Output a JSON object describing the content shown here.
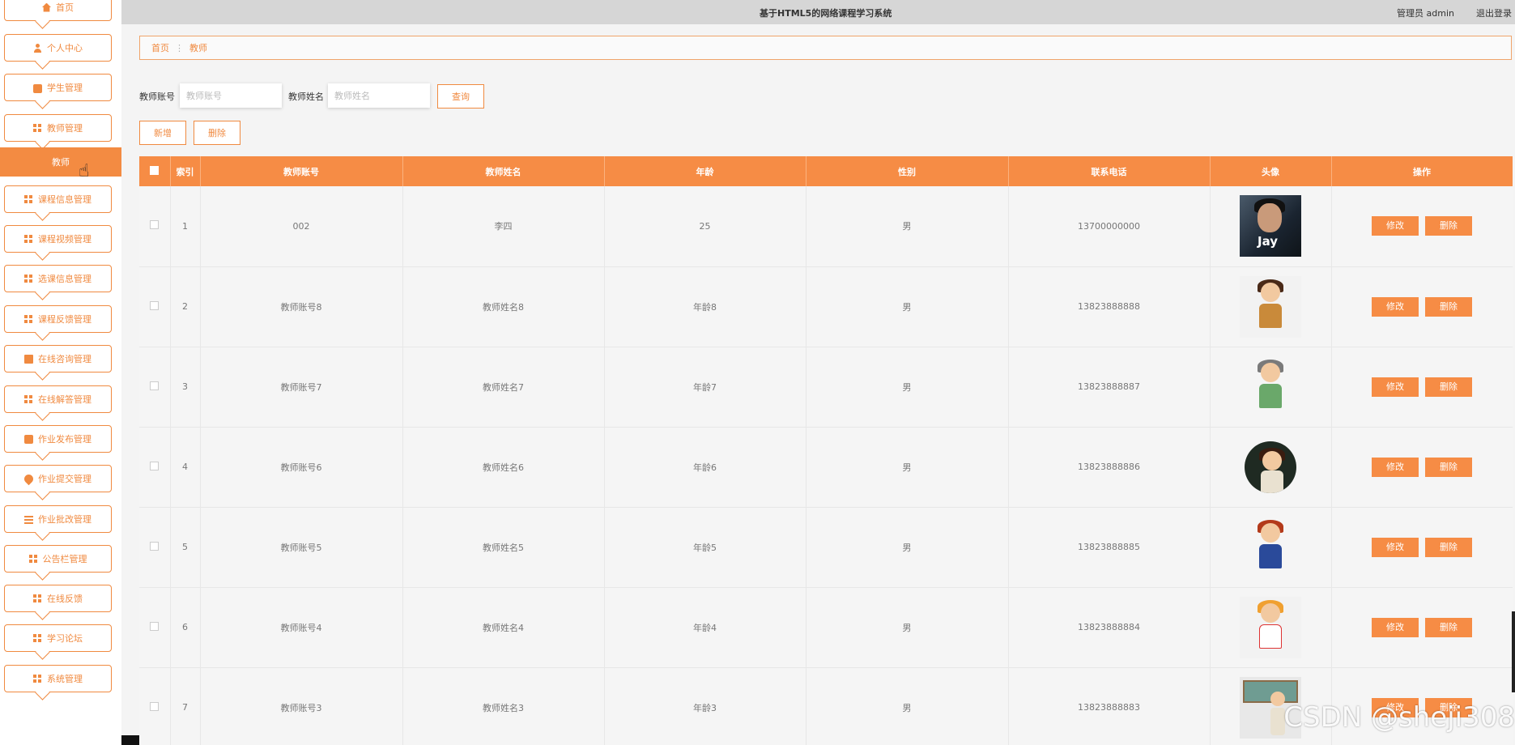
{
  "header": {
    "system_title": "基于HTML5的网络课程学习系统",
    "admin_info": "管理员 admin",
    "logout": "退出登录"
  },
  "sidebar": {
    "items": [
      {
        "label": "首页",
        "icon": "home-icon"
      },
      {
        "label": "个人中心",
        "icon": "user-icon"
      },
      {
        "label": "学生管理",
        "icon": "briefcase-icon"
      },
      {
        "label": "教师管理",
        "icon": "grid-icon"
      },
      {
        "label": "课程信息管理",
        "icon": "grid-icon"
      },
      {
        "label": "课程视频管理",
        "icon": "grid-icon"
      },
      {
        "label": "选课信息管理",
        "icon": "grid-icon"
      },
      {
        "label": "课程反馈管理",
        "icon": "grid-icon"
      },
      {
        "label": "在线咨询管理",
        "icon": "chat-icon"
      },
      {
        "label": "在线解答管理",
        "icon": "grid-icon"
      },
      {
        "label": "作业发布管理",
        "icon": "print-icon"
      },
      {
        "label": "作业提交管理",
        "icon": "pin-icon"
      },
      {
        "label": "作业批改管理",
        "icon": "list-icon"
      },
      {
        "label": "公告栏管理",
        "icon": "grid-icon"
      },
      {
        "label": "在线反馈",
        "icon": "grid-icon"
      },
      {
        "label": "学习论坛",
        "icon": "grid-icon"
      },
      {
        "label": "系统管理",
        "icon": "grid-icon"
      }
    ],
    "active_sub": "教师"
  },
  "breadcrumb": {
    "home": "首页",
    "current": "教师"
  },
  "search": {
    "account_label": "教师账号",
    "account_placeholder": "教师账号",
    "name_label": "教师姓名",
    "name_placeholder": "教师姓名",
    "query_button": "查询"
  },
  "toolbar": {
    "add_button": "新增",
    "delete_button": "删除"
  },
  "table": {
    "columns": [
      "索引",
      "教师账号",
      "教师姓名",
      "年龄",
      "性别",
      "联系电话",
      "头像",
      "操作"
    ],
    "rows": [
      {
        "index": "1",
        "account": "002",
        "name": "李四",
        "age": "25",
        "gender": "男",
        "phone": "13700000000",
        "avatar": "photo-avatar-icon"
      },
      {
        "index": "2",
        "account": "教师账号8",
        "name": "教师姓名8",
        "age": "年龄8",
        "gender": "男",
        "phone": "13823888888",
        "avatar": "cartoon-teacher-icon"
      },
      {
        "index": "3",
        "account": "教师账号7",
        "name": "教师姓名7",
        "age": "年龄7",
        "gender": "男",
        "phone": "13823888887",
        "avatar": "cartoon-teacher-icon"
      },
      {
        "index": "4",
        "account": "教师账号6",
        "name": "教师姓名6",
        "age": "年龄6",
        "gender": "男",
        "phone": "13823888886",
        "avatar": "cartoon-teacher-icon"
      },
      {
        "index": "5",
        "account": "教师账号5",
        "name": "教师姓名5",
        "age": "年龄5",
        "gender": "男",
        "phone": "13823888885",
        "avatar": "cartoon-teacher-icon"
      },
      {
        "index": "6",
        "account": "教师账号4",
        "name": "教师姓名4",
        "age": "年龄4",
        "gender": "男",
        "phone": "13823888884",
        "avatar": "cartoon-teacher-icon"
      },
      {
        "index": "7",
        "account": "教师账号3",
        "name": "教师姓名3",
        "age": "年龄3",
        "gender": "男",
        "phone": "13823888883",
        "avatar": "cartoon-teacher-icon"
      }
    ],
    "edit_label": "修改",
    "delete_label": "删除"
  },
  "watermark": "CSDN @sheji308",
  "colors": {
    "accent": "#f68c45",
    "header_bg": "#d6d6d6"
  }
}
